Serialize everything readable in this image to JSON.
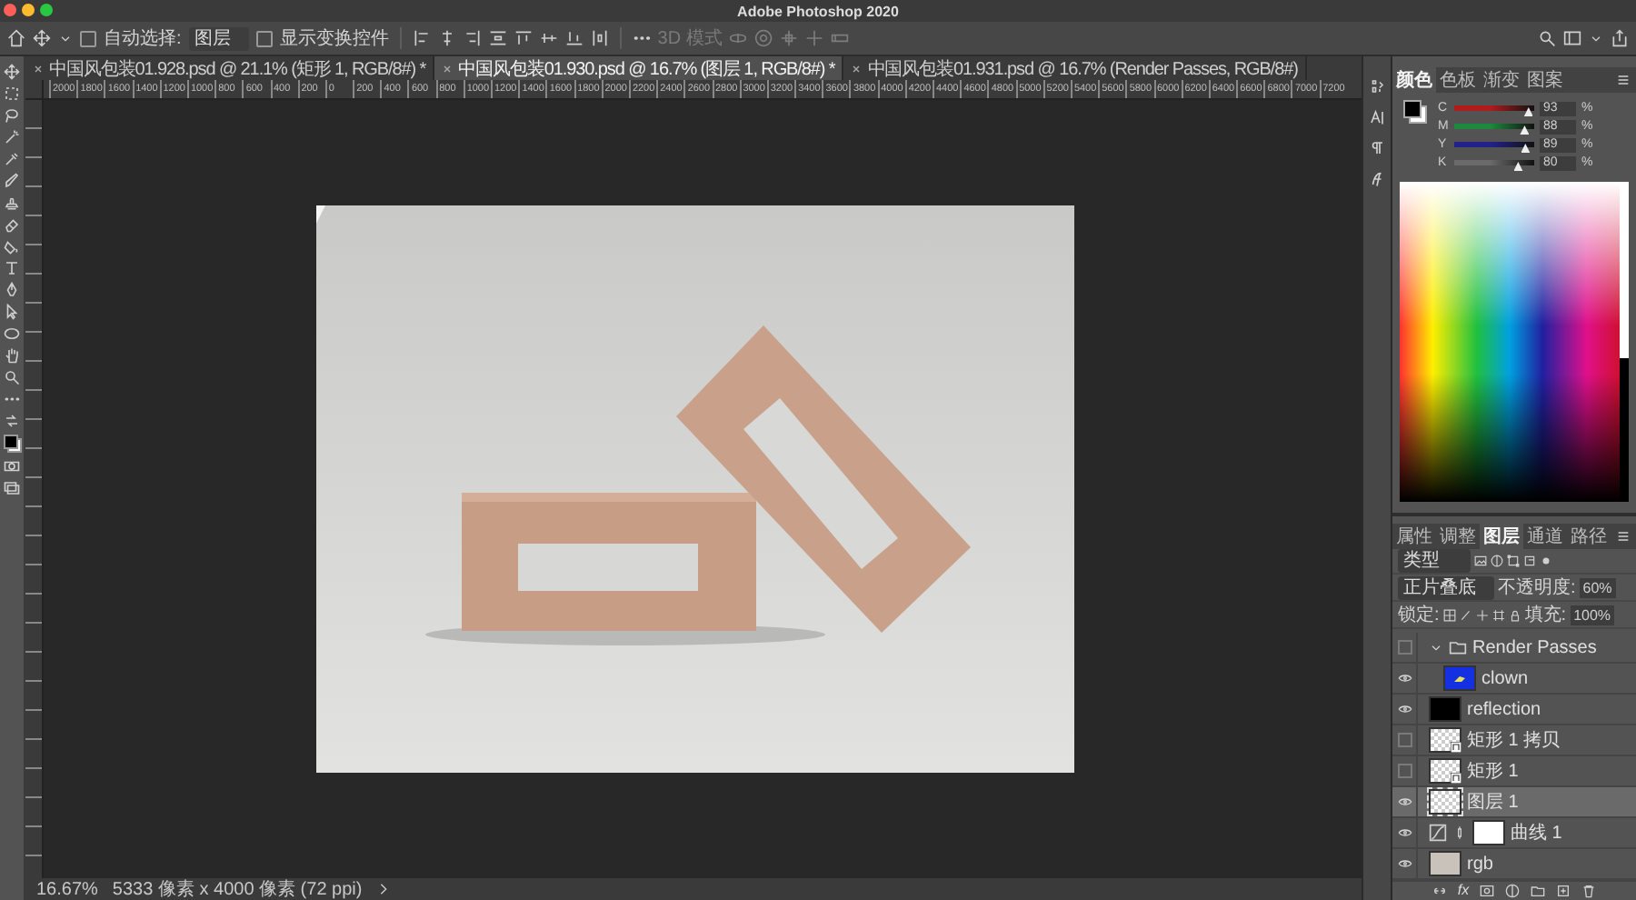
{
  "window": {
    "title": "Adobe Photoshop 2020"
  },
  "options_bar": {
    "auto_select_label": "自动选择:",
    "auto_select_checked": false,
    "auto_select_target": "图层",
    "transform_controls_label": "显示变换控件",
    "transform_controls_checked": false,
    "mode_3d_label": "3D 模式",
    "mode_3d_disabled": true
  },
  "document_tabs": [
    {
      "title": "中国风包装01.928.psd @ 21.1% (矩形 1, RGB/8#) *",
      "selected": false
    },
    {
      "title": "中国风包装01.930.psd @ 16.7% (图层 1, RGB/8#) *",
      "selected": true
    },
    {
      "title": "中国风包装01.931.psd @ 16.7% (Render Passes, RGB/8#)",
      "selected": false
    }
  ],
  "ruler": {
    "labels": [
      "2000",
      "1800",
      "1600",
      "1400",
      "1200",
      "1000",
      "800",
      "600",
      "400",
      "200",
      "0",
      "200",
      "400",
      "600",
      "800",
      "1000",
      "1200",
      "1400",
      "1600",
      "1800",
      "2000",
      "2200",
      "2400",
      "2600",
      "2800",
      "3000",
      "3200",
      "3400",
      "3600",
      "3800",
      "4000",
      "4200",
      "4400",
      "4600",
      "4800",
      "5000",
      "5200",
      "5400",
      "5600",
      "5800",
      "6000",
      "6200",
      "6400",
      "6600",
      "6800",
      "7000",
      "7200"
    ]
  },
  "status_bar": {
    "zoom": "16.67%",
    "document_size": "5333 像素 x 4000 像素 (72 ppi)"
  },
  "color_panel": {
    "tabs": [
      {
        "label": "颜色",
        "selected": true
      },
      {
        "label": "色板",
        "selected": false
      },
      {
        "label": "渐变",
        "selected": false
      },
      {
        "label": "图案",
        "selected": false
      }
    ],
    "channels": [
      {
        "name": "C",
        "color": "#b01c1c",
        "level": 0.93,
        "reading": "93",
        "unit": "%"
      },
      {
        "name": "M",
        "color": "#1c8a3c",
        "level": 0.88,
        "reading": "88",
        "unit": "%"
      },
      {
        "name": "Y",
        "color": "#22228a",
        "level": 0.89,
        "reading": "89",
        "unit": "%"
      },
      {
        "name": "K",
        "color": "#6a6a6a",
        "level": 0.8,
        "reading": "80",
        "unit": "%"
      }
    ]
  },
  "layers_panel": {
    "tabs": [
      {
        "label": "属性",
        "selected": false
      },
      {
        "label": "调整",
        "selected": false
      },
      {
        "label": "图层",
        "selected": true
      },
      {
        "label": "通道",
        "selected": false
      },
      {
        "label": "路径",
        "selected": false
      }
    ],
    "filter": "类型",
    "blend_mode": "正片叠底",
    "opacity_label": "不透明度:",
    "opacity": "60%",
    "lock_label": "锁定:",
    "fill_label": "填充:",
    "fill": "100%",
    "layers": [
      {
        "name": "Render Passes",
        "kind": "group",
        "visible": false,
        "selected": false,
        "expanded": true,
        "children": [
          {
            "name": "clown",
            "kind": "artwork",
            "visible": true,
            "selected": false
          }
        ]
      },
      {
        "name": "reflection",
        "kind": "solid",
        "visible": true,
        "selected": false
      },
      {
        "name": "矩形 1 拷贝",
        "kind": "smart-object",
        "visible": false,
        "selected": false
      },
      {
        "name": "矩形 1",
        "kind": "smart-object",
        "visible": false,
        "selected": false
      },
      {
        "name": "图层 1",
        "kind": "pixel",
        "visible": true,
        "selected": true
      },
      {
        "name": "曲线 1",
        "kind": "adjustment",
        "visible": true,
        "selected": false
      },
      {
        "name": "rgb",
        "kind": "photo",
        "visible": true,
        "selected": false
      }
    ],
    "footer_fx": "fx"
  }
}
